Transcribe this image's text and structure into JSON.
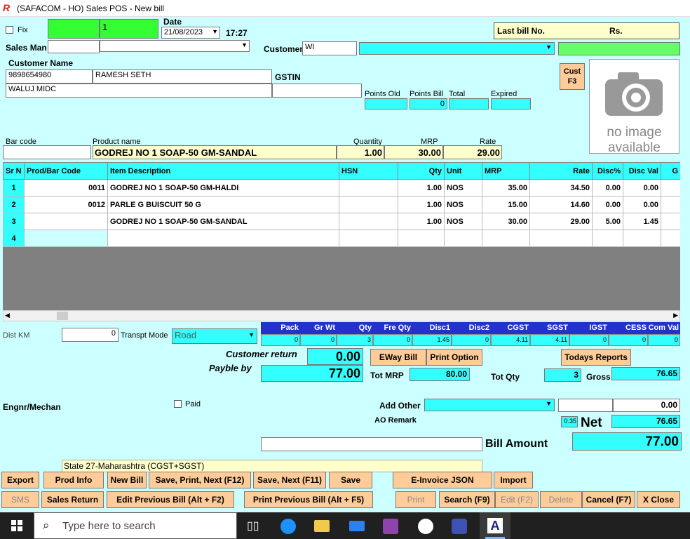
{
  "window": {
    "title": "(SAFACOM - HO) Sales POS - New bill",
    "logo": "R"
  },
  "header": {
    "fix_label": "Fix",
    "bill_no": "1",
    "date_label": "Date",
    "date": "21/08/2023",
    "time": "17:27",
    "last_bill_label": "Last bill No.",
    "rs_label": "Rs."
  },
  "salesman": {
    "label": "Sales Man",
    "customer_label": "Customer",
    "customer_code": "WI"
  },
  "customer": {
    "name_label": "Customer Name",
    "phone": "9898654980",
    "name": "RAMESH SETH",
    "address": "WALUJ MIDC",
    "gstin_label": "GSTIN",
    "cust_button": "Cust\nF3",
    "points_old_label": "Points Old",
    "points_bill_label": "Points Bill",
    "points_bill_value": "0",
    "total_label": "Total",
    "expired_label": "Expired"
  },
  "image": {
    "line1": "no image",
    "line2": "available"
  },
  "entry": {
    "barcode_label": "Bar code",
    "product_label": "Product name",
    "product": "GODREJ NO 1 SOAP-50 GM-SANDAL",
    "qty_label": "Quantity",
    "qty": "1.00",
    "mrp_label": "MRP",
    "mrp": "30.00",
    "rate_label": "Rate",
    "rate": "29.00"
  },
  "grid": {
    "columns": [
      "Sr N",
      "Prod/Bar Code",
      "Item Description",
      "HSN",
      "Qty",
      "Unit",
      "MRP",
      "Rate",
      "Disc%",
      "Disc Val",
      "G"
    ],
    "rows": [
      [
        "1",
        "0011",
        "GODREJ NO 1 SOAP-50 GM-HALDI",
        "",
        "1.00",
        "NOS",
        "35.00",
        "34.50",
        "0.00",
        "0.00"
      ],
      [
        "2",
        "0012",
        "PARLE G BUISCUIT 50 G",
        "",
        "1.00",
        "NOS",
        "15.00",
        "14.60",
        "0.00",
        "0.00"
      ],
      [
        "3",
        "",
        "GODREJ NO 1 SOAP-50 GM-SANDAL",
        "",
        "1.00",
        "NOS",
        "30.00",
        "29.00",
        "5.00",
        "1.45"
      ],
      [
        "4",
        "",
        "",
        "",
        "",
        "",
        "",
        "",
        "",
        ""
      ]
    ]
  },
  "transport": {
    "dist_label": "Dist KM",
    "dist_value": "0",
    "mode_label": "Transpt Mode",
    "mode_value": "Road"
  },
  "summary": {
    "headers": [
      "Pack",
      "Gr Wt",
      "Qty",
      "Fre Qty",
      "Disc1",
      "Disc2",
      "CGST",
      "SGST",
      "IGST",
      "CESS",
      "Com Val"
    ],
    "values": [
      "0",
      "0",
      "3",
      "0",
      "1.45",
      "0",
      "4.11",
      "4.11",
      "0",
      "0",
      "0"
    ]
  },
  "totals": {
    "customer_return_label": "Customer return",
    "customer_return": "0.00",
    "payble_label": "Payble by",
    "payble": "77.00",
    "tot_mrp_label": "Tot MRP",
    "tot_mrp": "80.00",
    "tot_qty_label": "Tot Qty",
    "tot_qty": "3",
    "gross_label": "Gross",
    "gross": "76.65",
    "add_other_label": "Add Other",
    "add_other_value": "0.00",
    "ao_remark_label": "AO Remark",
    "round": "0.35",
    "net_label": "Net",
    "net": "76.65",
    "bill_amount_label": "Bill Amount",
    "bill_amount": "77.00",
    "engnr_label": "Engnr/Mechan",
    "paid_label": "Paid",
    "state": "State 27-Maharashtra (CGST+SGST)"
  },
  "mid_buttons": {
    "eway": "EWay Bill",
    "print_option": "Print Option",
    "todays_reports": "Todays Reports"
  },
  "buttons_row1": {
    "export": "Export",
    "prod_info": "Prod Info",
    "new_bill": "New Bill",
    "save_print_next": "Save, Print, Next (F12)",
    "save_next": "Save, Next (F11)",
    "save": "Save",
    "einvoice": "E-Invoice JSON",
    "import": "Import"
  },
  "buttons_row2": {
    "sms": "SMS",
    "sales_return": "Sales Return",
    "edit_prev": "Edit Previous Bill (Alt + F2)",
    "print_prev": "Print Previous Bill (Alt + F5)",
    "print": "Print",
    "search": "Search (F9)",
    "edit": "Edit (F2)",
    "delete": "Delete",
    "cancel": "Cancel (F7)",
    "close": "X  Close"
  },
  "taskbar": {
    "search_placeholder": "Type here to search"
  },
  "colors": {
    "bg": "#ccffff",
    "cyan": "#33ffff",
    "button": "#ffcc99",
    "green": "#33ff33",
    "yellow": "#ffffcc"
  }
}
